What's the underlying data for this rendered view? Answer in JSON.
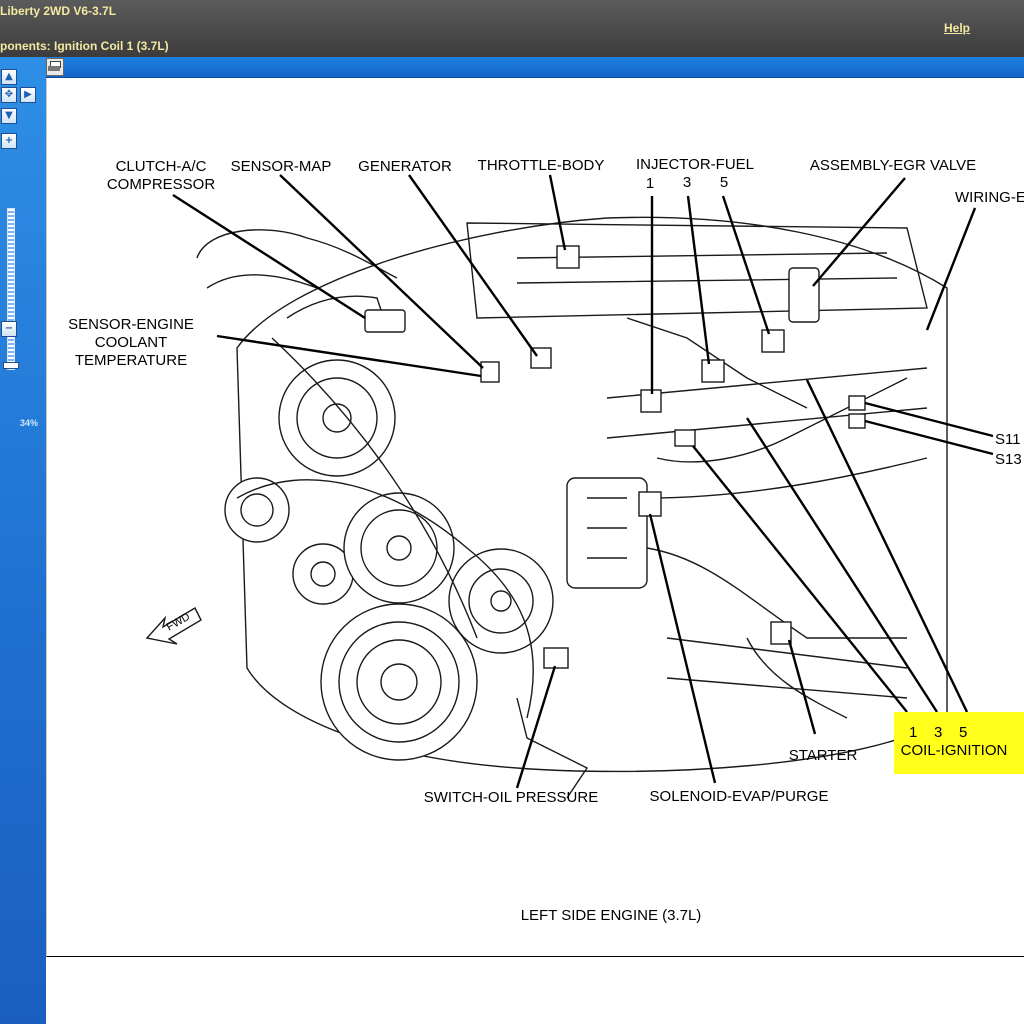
{
  "window": {
    "vehicle_title": "Liberty 2WD V6-3.7L",
    "breadcrumb": "ponents: Ignition Coil 1 (3.7L)",
    "help_label": "Help"
  },
  "toolbar": {
    "print_icon": "print-icon"
  },
  "nav": {
    "pan_up_icon": "arrow-up-icon",
    "pan_left_icon": "arrow-left-icon",
    "pan_center_icon": "move-icon",
    "pan_right_icon": "arrow-right-icon",
    "pan_down_icon": "arrow-down-icon",
    "zoom_in_icon": "plus-icon",
    "zoom_out_icon": "minus-icon",
    "zoom_level": "34%",
    "zoom_fraction": 0.34
  },
  "diagram": {
    "labels": {
      "clutch_line1": "CLUTCH-A/C",
      "clutch_line2": "COMPRESSOR",
      "sensor_map": "SENSOR-MAP",
      "generator": "GENERATOR",
      "throttle_body": "THROTTLE-BODY",
      "injector_fuel": "INJECTOR-FUEL",
      "injector_1": "1",
      "injector_3": "3",
      "injector_5": "5",
      "egr_valve": "ASSEMBLY-EGR VALVE",
      "wiring": "WIRING-E",
      "ect_line1": "SENSOR-ENGINE",
      "ect_line2": "COOLANT",
      "ect_line3": "TEMPERATURE",
      "s11": "S11",
      "s13": "S13",
      "fwd": "FWD",
      "starter": "STARTER",
      "coil_numbers": "1    3    5",
      "coil_ignition": "COIL-IGNITION",
      "oil_pressure": "SWITCH-OIL PRESSURE",
      "evap_purge": "SOLENOID-EVAP/PURGE",
      "caption": "LEFT SIDE ENGINE  (3.7L)"
    },
    "highlight_color": "#ffff1a"
  }
}
